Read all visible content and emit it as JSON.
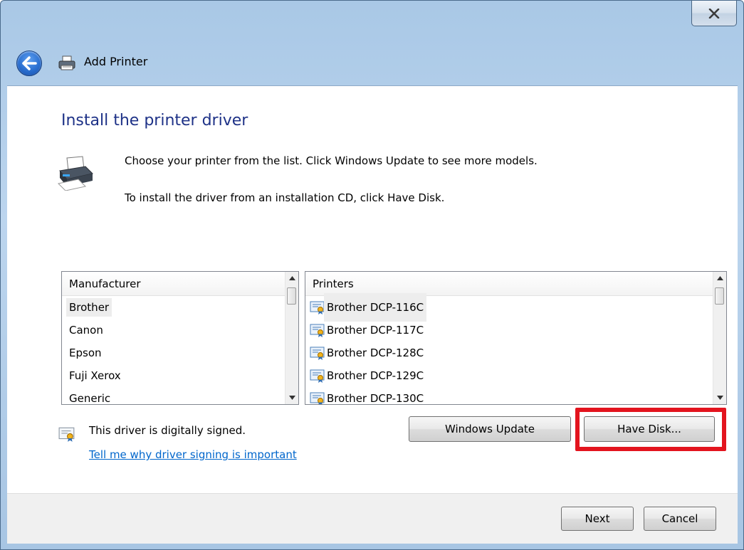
{
  "window": {
    "title": "Add Printer",
    "close_label": "X"
  },
  "main": {
    "heading": "Install the printer driver",
    "instruction_1": "Choose your printer from the list. Click Windows Update to see more models.",
    "instruction_2": "To install the driver from an installation CD, click Have Disk."
  },
  "manufacturer_list": {
    "header": "Manufacturer",
    "items": [
      "Brother",
      "Canon",
      "Epson",
      "Fuji Xerox",
      "Generic"
    ],
    "selected": "Brother"
  },
  "printer_list": {
    "header": "Printers",
    "items": [
      "Brother DCP-116C",
      "Brother DCP-117C",
      "Brother DCP-128C",
      "Brother DCP-129C",
      "Brother DCP-130C"
    ],
    "selected": "Brother DCP-116C"
  },
  "signing": {
    "status": "This driver is digitally signed.",
    "link": "Tell me why driver signing is important"
  },
  "buttons": {
    "windows_update": "Windows Update",
    "have_disk": "Have Disk...",
    "next": "Next",
    "cancel": "Cancel"
  },
  "icons": {
    "back": "back-arrow-icon",
    "printer": "printer-icon",
    "certificate": "certificate-icon",
    "close": "close-icon"
  },
  "colors": {
    "heading": "#1e3287",
    "link": "#0066cc",
    "highlight": "#e3141e",
    "frame": "#bcd5ee"
  }
}
